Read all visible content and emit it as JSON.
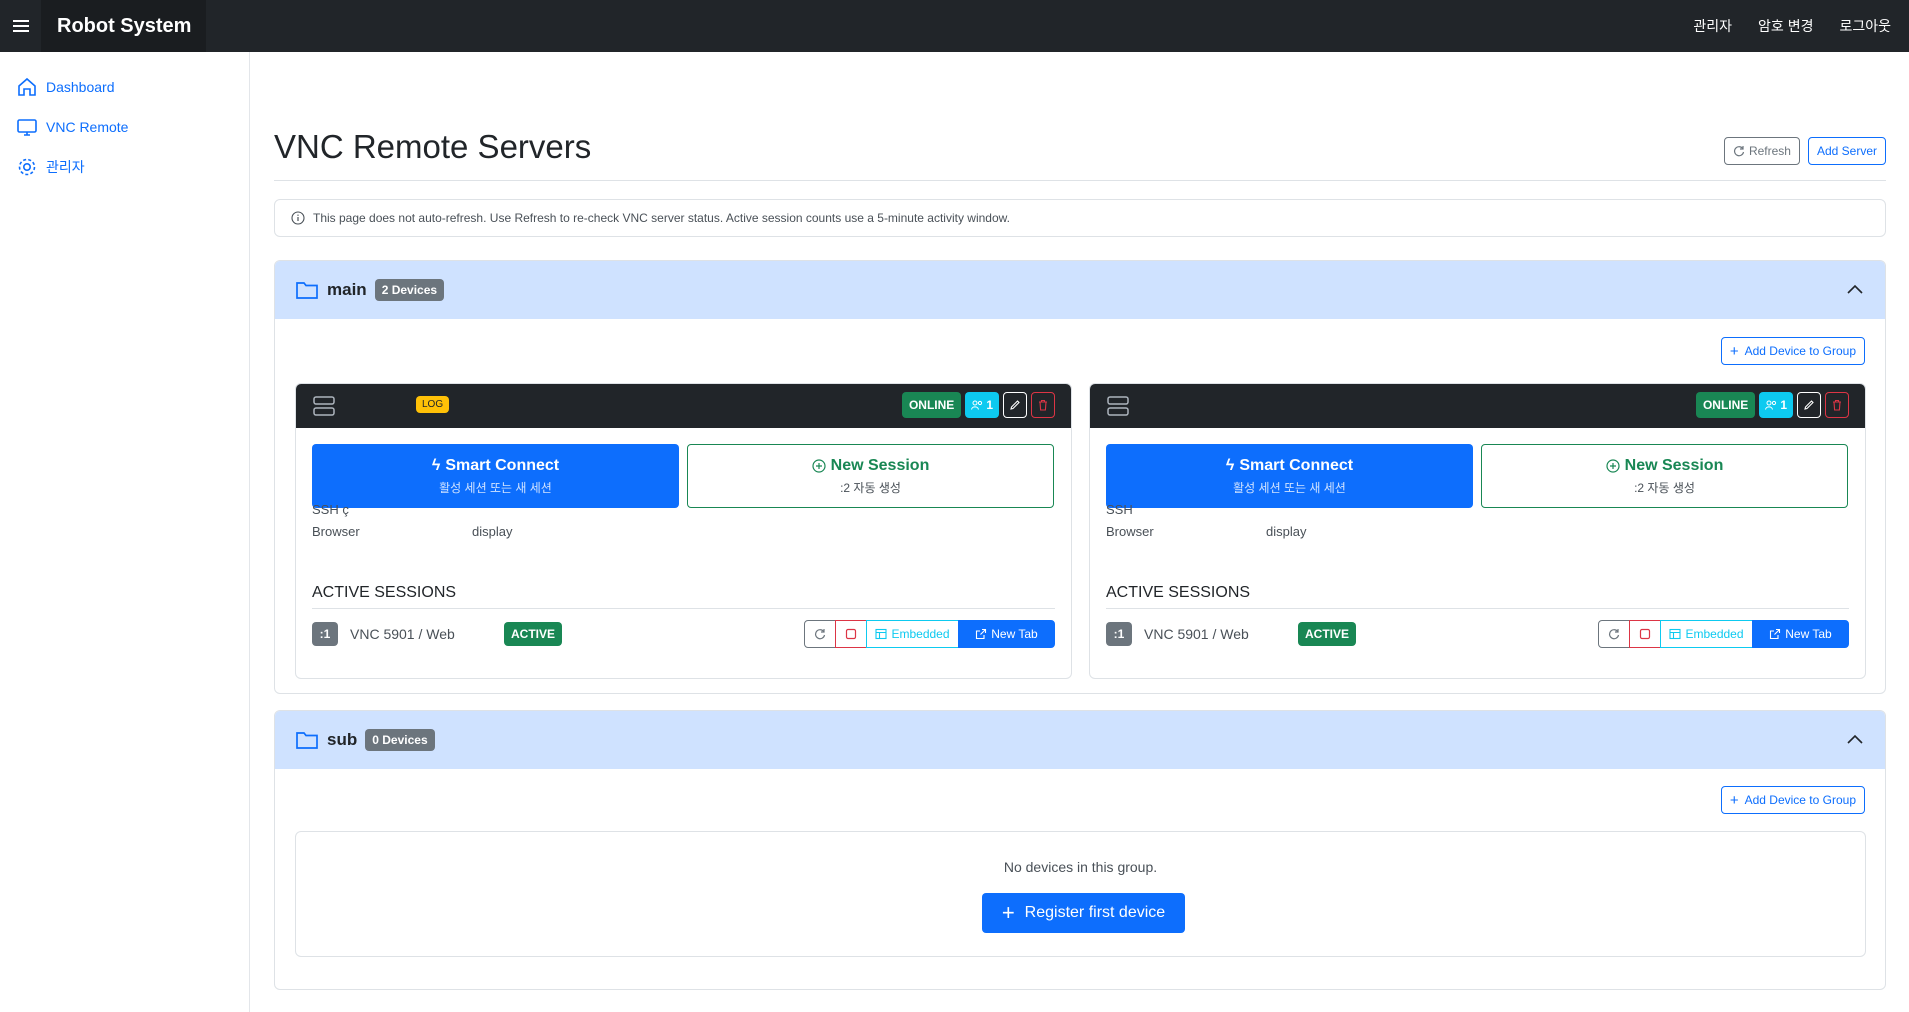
{
  "topbar": {
    "brand": "Robot System",
    "links": [
      "관리자",
      "암호 변경",
      "로그아웃"
    ]
  },
  "sidebar": {
    "items": [
      {
        "label": "Dashboard",
        "icon": "home-icon"
      },
      {
        "label": "VNC Remote",
        "icon": "monitor-icon"
      },
      {
        "label": "관리자",
        "icon": "gear-icon"
      }
    ]
  },
  "page": {
    "title": "VNC Remote Servers",
    "refresh_label": "Refresh",
    "add_server_label": "Add Server",
    "info_text": "This page does not auto-refresh. Use Refresh to re-check VNC server status. Active session counts use a 5-minute activity window."
  },
  "groups": [
    {
      "name": "main",
      "count_label": "2 Devices",
      "add_label": "Add Device to Group",
      "devices": [
        {
          "log_badge": "LOG",
          "status": "ONLINE",
          "user_count": "1",
          "smart_title": "Smart Connect",
          "smart_sub": "활성 세션 또는 새 세션",
          "new_title": "New Session",
          "new_sub": ":2 자동 생성",
          "ssh_label": "SSH",
          "ssh_value": "ç",
          "browser_label": "Browser",
          "browser_value": "display",
          "sessions_title": "ACTIVE SESSIONS",
          "session": {
            "display": ":1",
            "text": "VNC 5901 / Web",
            "state": "ACTIVE",
            "embedded": "Embedded",
            "new_tab": "New Tab"
          }
        },
        {
          "log_badge": "",
          "status": "ONLINE",
          "user_count": "1",
          "smart_title": "Smart Connect",
          "smart_sub": "활성 세션 또는 새 세션",
          "new_title": "New Session",
          "new_sub": ":2 자동 생성",
          "ssh_label": "SSH",
          "ssh_value": "",
          "browser_label": "Browser",
          "browser_value": "display",
          "sessions_title": "ACTIVE SESSIONS",
          "session": {
            "display": ":1",
            "text": "VNC 5901 / Web",
            "state": "ACTIVE",
            "embedded": "Embedded",
            "new_tab": "New Tab"
          }
        }
      ]
    },
    {
      "name": "sub",
      "count_label": "0 Devices",
      "add_label": "Add Device to Group",
      "empty_text": "No devices in this group.",
      "register_label": "Register first device"
    }
  ],
  "colors": {
    "primary": "#0d6efd",
    "success": "#198754",
    "info": "#0dcaf0",
    "danger": "#dc3545",
    "warning": "#ffc107",
    "dark": "#212529",
    "group_header": "#cfe2ff"
  }
}
